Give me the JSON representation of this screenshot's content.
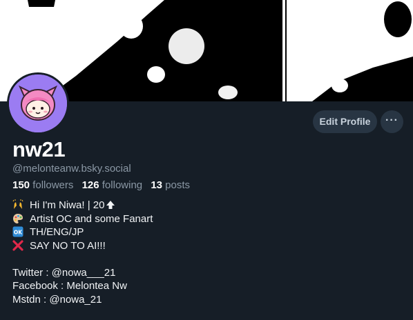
{
  "profile": {
    "display_name": "nw21",
    "handle": "@melonteanw.bsky.social"
  },
  "stats": {
    "followers_count": "150",
    "followers_label": "followers",
    "following_count": "126",
    "following_label": "following",
    "posts_count": "13",
    "posts_label": "posts"
  },
  "actions": {
    "edit_profile_label": "Edit Profile",
    "more_label": "···"
  },
  "bio": {
    "lines": [
      {
        "emoji": "raising-hands-icon",
        "text": "Hi I'm Niwa! | 20"
      },
      {
        "emoji": "artist-palette-icon",
        "text": "Artist OC and some Fanart"
      },
      {
        "emoji": "ok-button-icon",
        "text": "TH/ENG/JP"
      },
      {
        "emoji": "cross-mark-icon",
        "text": "SAY NO TO AI!!!"
      },
      {
        "text": ""
      },
      {
        "text": "Twitter : @nowa___21"
      },
      {
        "text": "Facebook : Melontea Nw"
      },
      {
        "text": "Mstdn : @nowa_21"
      }
    ]
  },
  "colors": {
    "background": "#161e27",
    "button_bg": "#283543",
    "avatar_bg": "#9b7cf2",
    "muted_text": "#8b98a5"
  }
}
